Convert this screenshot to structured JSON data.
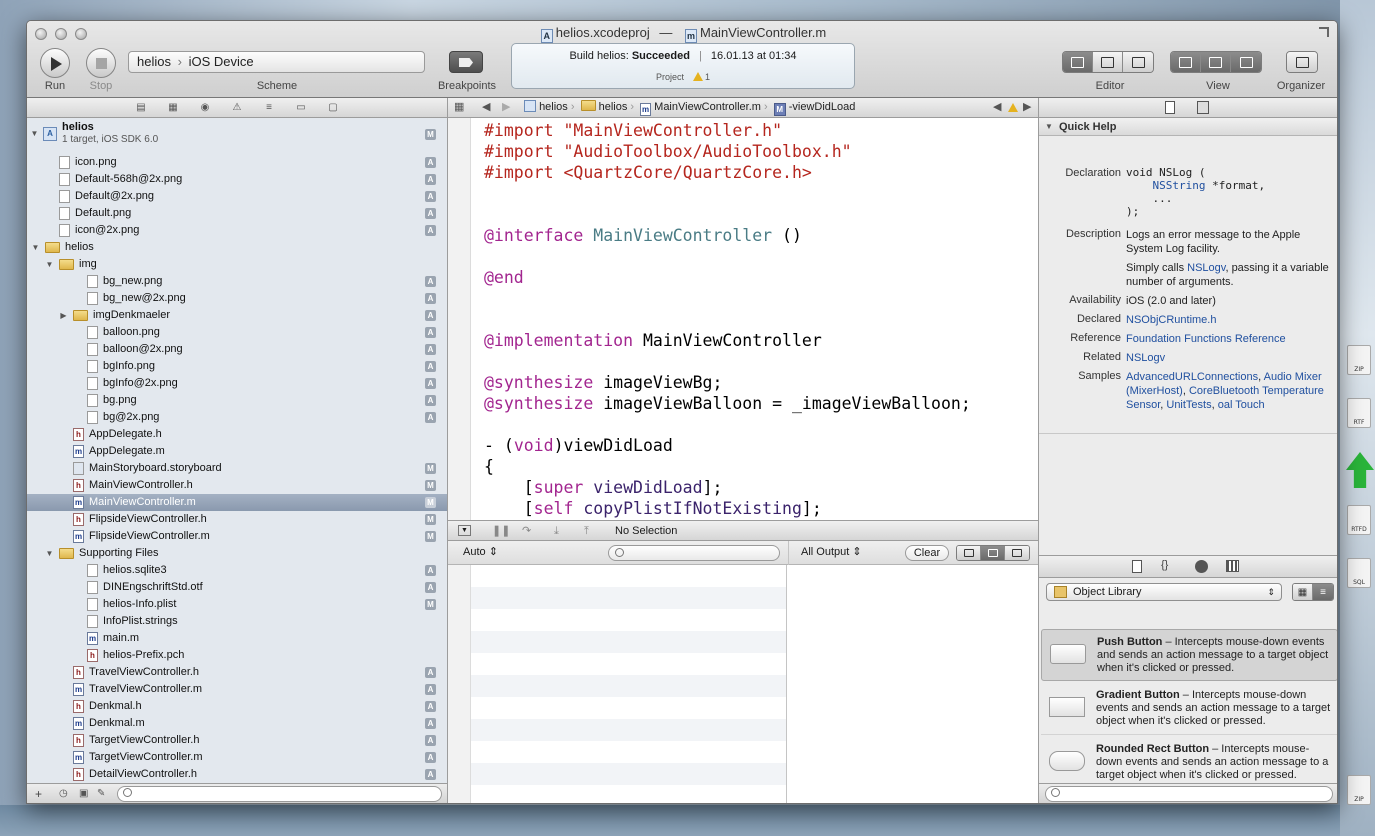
{
  "window": {
    "project_file": "helios.xcodeproj",
    "title_separator": "—",
    "current_file": "MainViewController.m"
  },
  "toolbar": {
    "run_label": "Run",
    "stop_label": "Stop",
    "scheme_target": "helios",
    "scheme_device": "iOS Device",
    "scheme_label": "Scheme",
    "breakpoints_label": "Breakpoints",
    "editor_label": "Editor",
    "view_label": "View",
    "organizer_label": "Organizer"
  },
  "status": {
    "prefix": "Build helios:",
    "result": "Succeeded",
    "divider": "|",
    "timestamp": "16.01.13 at 01:34",
    "project_label": "Project",
    "warning_count": "1"
  },
  "navigator": {
    "project_name": "helios",
    "project_subtitle": "1 target, iOS SDK 6.0",
    "project_badge": "M",
    "rows": [
      {
        "name": "icon.png",
        "badge": "A"
      },
      {
        "name": "Default-568h@2x.png",
        "badge": "A"
      },
      {
        "name": "Default@2x.png",
        "badge": "A"
      },
      {
        "name": "Default.png",
        "badge": "A"
      },
      {
        "name": "icon@2x.png",
        "badge": "A"
      },
      {
        "name": "helios",
        "badge": ""
      },
      {
        "name": "img",
        "badge": ""
      },
      {
        "name": "bg_new.png",
        "badge": "A"
      },
      {
        "name": "bg_new@2x.png",
        "badge": "A"
      },
      {
        "name": "imgDenkmaeler",
        "badge": "A"
      },
      {
        "name": "balloon.png",
        "badge": "A"
      },
      {
        "name": "balloon@2x.png",
        "badge": "A"
      },
      {
        "name": "bgInfo.png",
        "badge": "A"
      },
      {
        "name": "bgInfo@2x.png",
        "badge": "A"
      },
      {
        "name": "bg.png",
        "badge": "A"
      },
      {
        "name": "bg@2x.png",
        "badge": "A"
      },
      {
        "name": "AppDelegate.h",
        "badge": ""
      },
      {
        "name": "AppDelegate.m",
        "badge": ""
      },
      {
        "name": "MainStoryboard.storyboard",
        "badge": "M"
      },
      {
        "name": "MainViewController.h",
        "badge": "M"
      },
      {
        "name": "MainViewController.m",
        "badge": "M"
      },
      {
        "name": "FlipsideViewController.h",
        "badge": "M"
      },
      {
        "name": "FlipsideViewController.m",
        "badge": "M"
      },
      {
        "name": "Supporting Files",
        "badge": ""
      },
      {
        "name": "helios.sqlite3",
        "badge": "A"
      },
      {
        "name": "DINEngschriftStd.otf",
        "badge": "A"
      },
      {
        "name": "helios-Info.plist",
        "badge": "M"
      },
      {
        "name": "InfoPlist.strings",
        "badge": ""
      },
      {
        "name": "main.m",
        "badge": ""
      },
      {
        "name": "helios-Prefix.pch",
        "badge": ""
      },
      {
        "name": "TravelViewController.h",
        "badge": "A"
      },
      {
        "name": "TravelViewController.m",
        "badge": "A"
      },
      {
        "name": "Denkmal.h",
        "badge": "A"
      },
      {
        "name": "Denkmal.m",
        "badge": "A"
      },
      {
        "name": "TargetViewController.h",
        "badge": "A"
      },
      {
        "name": "TargetViewController.m",
        "badge": "A"
      },
      {
        "name": "DetailViewController.h",
        "badge": "A"
      }
    ]
  },
  "jumpbar": {
    "crumbs": [
      "helios",
      "helios",
      "MainViewController.m",
      "-viewDidLoad"
    ]
  },
  "code": {
    "lines": [
      {
        "a": "#import ",
        "b": "\"MainViewController.h\"",
        "c": ""
      },
      {
        "a": "#import ",
        "b": "\"AudioToolbox/AudioToolbox.h\"",
        "c": ""
      },
      {
        "a": "#import ",
        "b": "<QuartzCore/QuartzCore.h>",
        "c": ""
      },
      {
        "a": "@interface",
        "b": " MainViewController",
        "c": " ()"
      },
      {
        "a": "@end",
        "b": "",
        "c": ""
      },
      {
        "a": "@implementation",
        "b": "",
        "c": " MainViewController"
      },
      {
        "a": "@synthesize",
        "b": "",
        "c": " imageViewBg;"
      },
      {
        "a": "@synthesize",
        "b": "",
        "c": " imageViewBalloon = _imageViewBalloon;"
      },
      {
        "a": "- (",
        "b": "void",
        "c": ")viewDidLoad"
      },
      {
        "a": "{",
        "b": "",
        "c": ""
      },
      {
        "a": "    [",
        "b": "super",
        "c": " viewDidLoad",
        "d": "];"
      },
      {
        "a": "    [",
        "b": "self",
        "c": " copyPlistIfNotExisting",
        "d": "];"
      }
    ]
  },
  "debug": {
    "selection": "No Selection",
    "auto_label": "Auto",
    "output_label": "All Output",
    "clear_label": "Clear"
  },
  "quickhelp": {
    "header": "Quick Help",
    "declaration_label": "Declaration",
    "declaration_line1": "void NSLog (",
    "declaration_type": "NSString",
    "declaration_line2": " *format,",
    "declaration_line3": "    ...",
    "declaration_line4": ");",
    "description_label": "Description",
    "description_1": "Logs an error message to the Apple System Log facility.",
    "description_2a": "Simply calls ",
    "description_2link": "NSLogv",
    "description_2b": ", passing it a variable number of arguments.",
    "availability_label": "Availability",
    "availability": "iOS (2.0 and later)",
    "declared_label": "Declared",
    "declared": "NSObjCRuntime.h",
    "reference_label": "Reference",
    "reference": "Foundation Functions Reference",
    "related_label": "Related",
    "related": "NSLogv",
    "samples_label": "Samples",
    "samples": [
      "AdvancedURLConnections",
      "Audio Mixer (MixerHost)",
      "CoreBluetooth Temperature Sensor",
      "UnitTests",
      "oal Touch"
    ]
  },
  "library": {
    "selected": "Object Library",
    "items": [
      {
        "title": "Push Button",
        "desc": " – Intercepts mouse-down events and sends an action message to a target object when it's clicked or pressed."
      },
      {
        "title": "Gradient Button",
        "desc": " – Intercepts mouse-down events and sends an action message to a target object when it's clicked or pressed."
      },
      {
        "title": "Rounded Rect Button",
        "desc": " – Intercepts mouse-down events and sends an action message to a target object when it's clicked or pressed."
      }
    ]
  },
  "desktop_files": [
    "ZIP",
    "RTF",
    "RTFD",
    "SQL",
    "ZIP"
  ]
}
